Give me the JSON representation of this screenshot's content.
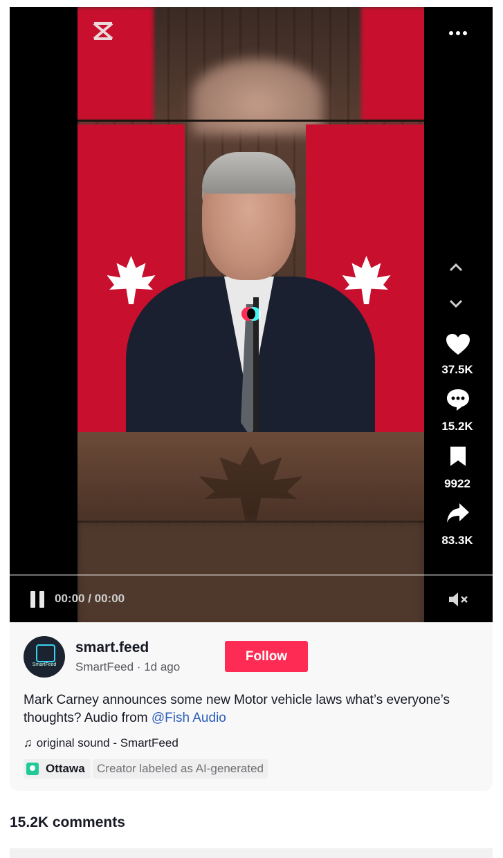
{
  "video": {
    "time": "00:00 / 00:00",
    "more_icon": "more-dots-icon",
    "watermark_icon": "capcut-icon",
    "progress_fraction": 0
  },
  "actions": [
    {
      "icon": "heart-icon",
      "count": "37.5K"
    },
    {
      "icon": "comment-icon",
      "count": "15.2K"
    },
    {
      "icon": "bookmark-icon",
      "count": "9922"
    },
    {
      "icon": "share-icon",
      "count": "83.3K"
    }
  ],
  "author": {
    "username": "smart.feed",
    "nickname_date": "SmartFeed · 1d ago",
    "avatar_text": "SmartFeed",
    "follow_label": "Follow"
  },
  "caption": {
    "text": "Mark Carney announces some new Motor vehicle laws what’s everyone’s thoughts? Audio from ",
    "mention": "@Fish Audio"
  },
  "sound": {
    "label": "original sound - SmartFeed"
  },
  "location": {
    "label": "Ottawa"
  },
  "ai_label": {
    "text": "Creator labeled as AI-generated"
  },
  "comments": {
    "title": "15.2K comments"
  },
  "colors": {
    "accent": "#fe2c55",
    "mention": "#2b5db9",
    "location_pin": "#20c997"
  }
}
